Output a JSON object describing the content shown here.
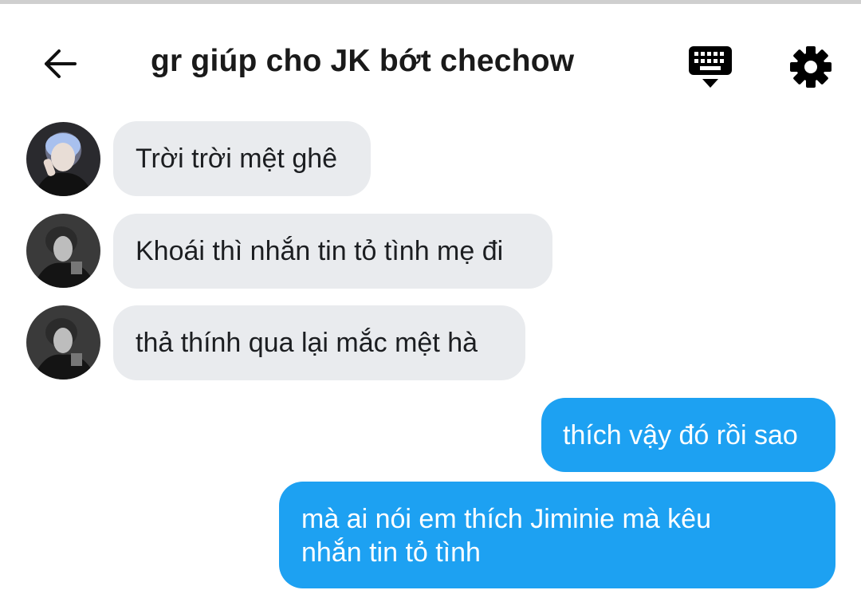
{
  "header": {
    "title": "gr giúp cho JK bớt chechow",
    "back_icon": "arrow-left-icon",
    "keyboard_icon": "keyboard-icon",
    "settings_icon": "gear-icon"
  },
  "messages": [
    {
      "direction": "incoming",
      "text": "Trời trời mệt ghê",
      "avatar": "avatar-blue-hair"
    },
    {
      "direction": "incoming",
      "text": "Khoái thì nhắn tin tỏ tình mẹ đi",
      "avatar": "avatar-bw"
    },
    {
      "direction": "incoming",
      "text": "thả thính qua lại mắc mệt hà",
      "avatar": "avatar-bw"
    },
    {
      "direction": "outgoing",
      "text": "thích vậy đó rồi sao"
    },
    {
      "direction": "outgoing",
      "lines": [
        "mà ai nói em thích Jiminie mà kêu",
        "nhắn tin tỏ tình"
      ]
    }
  ],
  "colors": {
    "incoming_bubble": "#e9ebee",
    "outgoing_bubble": "#1da1f2",
    "text_dark": "#1c1e21"
  }
}
